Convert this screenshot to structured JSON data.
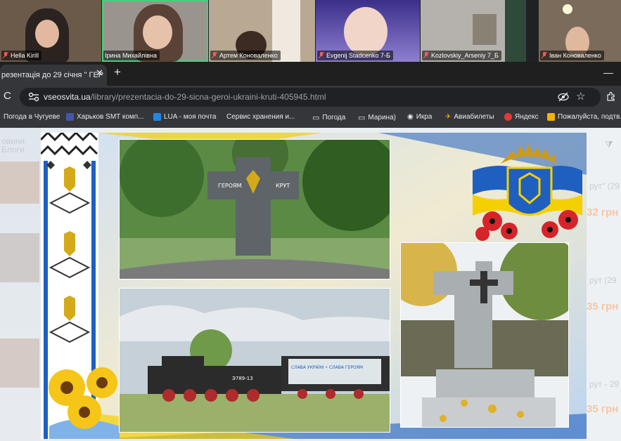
{
  "participants": [
    {
      "name": "Hella Kirill",
      "bg": "#6b5a4a"
    },
    {
      "name": "Ірина Михайлівна",
      "bg": "#8d8a86"
    },
    {
      "name": "Артем Коноваленко",
      "bg": "#9b8a78"
    },
    {
      "name": "Evgenij Stadcenko 7-Б",
      "bg": "#4a3e8e"
    },
    {
      "name": "Kozlovskiy_Arseniy 7_Б",
      "bg": "#b5b2ad"
    },
    {
      "name": "Іван Коноваленко",
      "bg": "#7b6b5b"
    }
  ],
  "browser": {
    "tab_title": "резентація до 29 січня \" ГЕР",
    "tab_close": "✕",
    "new_tab": "+",
    "minimize": "—",
    "reload": "C",
    "url_host": "vseosvita.ua",
    "url_path": "/library/prezentacia-do-29-sicna-geroi-ukraini-kruti-405945.html"
  },
  "bookmarks": [
    {
      "label": "Погода в Чугуеве",
      "color": "#2d6cdf"
    },
    {
      "label": "Харьков SMT комп...",
      "color": "#4457a8"
    },
    {
      "label": "LUA - моя почта",
      "color": "#1e88e5"
    },
    {
      "label": "Сервис хранения и...",
      "color": "#6d6d6d"
    },
    {
      "label": "Погода",
      "color": "folder"
    },
    {
      "label": "Марина)",
      "color": "folder"
    },
    {
      "label": "Икра",
      "color": "#e8eaed"
    },
    {
      "label": "Авиабилеты",
      "color": "#f4b400"
    },
    {
      "label": "Яндекс",
      "color": "#e53935"
    },
    {
      "label": "Пожалуйста, подтв...",
      "color": "#f4b400"
    }
  ],
  "background_page": {
    "left_heading": "овини",
    "left_heading2": "Блоги",
    "right_texts": [
      "рут\" (29",
      "32 грн",
      "рут (29",
      "35 грн",
      "рут - 29",
      "35 грн"
    ]
  },
  "slide": {
    "monument_plaque_left": "ГЕРОЯМ",
    "monument_plaque_right": "КРУТ",
    "train_banner": "СЛАВА УКРАЇНІ • СЛАВА ГЕРОЯМ",
    "train_number": "Э789-13"
  },
  "colors": {
    "ukraine_blue": "#1f5fbf",
    "ukraine_yellow": "#f5d000"
  }
}
